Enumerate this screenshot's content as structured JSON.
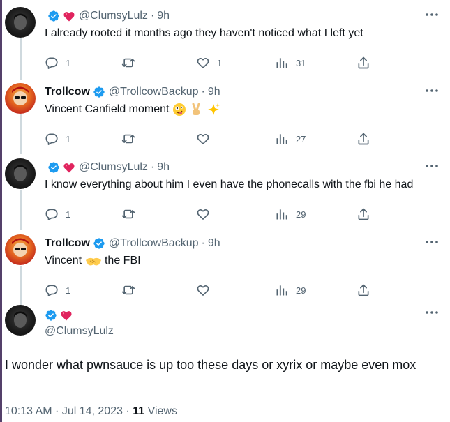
{
  "replies": [
    {
      "name": "",
      "handle": "@ClumsyLulz",
      "time": "9h",
      "text": "I already rooted it months ago they haven't noticed what I left yet",
      "reply_count": "1",
      "retweet_count": "",
      "like_count": "1",
      "view_count": "31"
    },
    {
      "name": "Trollcow",
      "handle": "@TrollcowBackup",
      "time": "9h",
      "text": "Vincent Canfield moment",
      "reply_count": "1",
      "retweet_count": "",
      "like_count": "",
      "view_count": "27"
    },
    {
      "name": "",
      "handle": "@ClumsyLulz",
      "time": "9h",
      "text": "I know everything about him I even have the phonecalls with the fbi he had",
      "reply_count": "1",
      "retweet_count": "",
      "like_count": "",
      "view_count": "29"
    },
    {
      "name": "Trollcow",
      "handle": "@TrollcowBackup",
      "time": "9h",
      "text_before": "Vincent",
      "text_after": "the FBI",
      "reply_count": "1",
      "retweet_count": "",
      "like_count": "",
      "view_count": "29"
    }
  ],
  "main": {
    "handle": "@ClumsyLulz",
    "text": "I wonder what pwnsauce is up too these days or xyrix or maybe even mox",
    "timestamp": "10:13 AM · Jul 14, 2023 · ",
    "views_count": "11",
    "views_label": " Views"
  },
  "colors": {
    "verified": "#1d9bf0",
    "heart": "#e0245e",
    "muted": "#536471",
    "text": "#0f1419",
    "thread_line": "#cfd9de"
  },
  "icons": [
    "verified-badge-icon",
    "heart-emoji-icon",
    "more-icon",
    "reply-icon",
    "retweet-icon",
    "like-icon",
    "views-icon",
    "share-icon"
  ]
}
